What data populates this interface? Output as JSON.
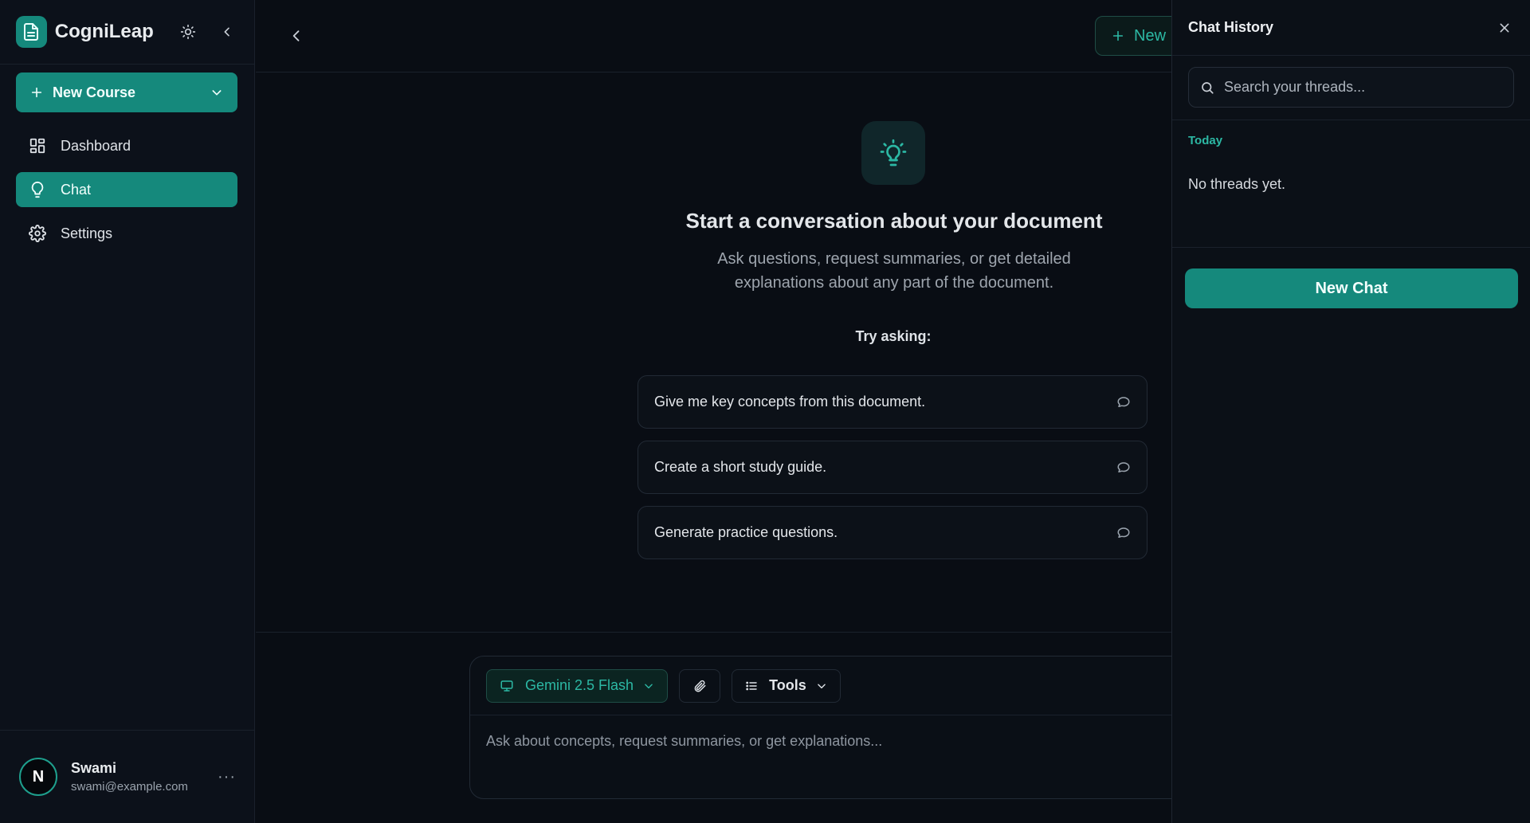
{
  "app": {
    "name": "CogniLeap"
  },
  "sidebar": {
    "new_course_label": "New Course",
    "items": [
      {
        "label": "Dashboard",
        "icon": "dashboard-icon",
        "active": false
      },
      {
        "label": "Chat",
        "icon": "lightbulb-icon",
        "active": true
      },
      {
        "label": "Settings",
        "icon": "gear-icon",
        "active": false
      }
    ],
    "user": {
      "initial": "N",
      "name": "Swami",
      "email": "swami@example.com",
      "more_label": "···"
    }
  },
  "main": {
    "new_button_label": "New",
    "empty_state": {
      "title": "Start a conversation about your document",
      "subtitle": "Ask questions, request summaries, or get detailed explanations about any part of the document.",
      "try_label": "Try asking:",
      "suggestions": [
        "Give me key concepts from this document.",
        "Create a short study guide.",
        "Generate practice questions."
      ]
    },
    "composer": {
      "model_label": "Gemini 2.5 Flash",
      "tools_label": "Tools",
      "input_placeholder": "Ask about concepts, request summaries, or get explanations..."
    }
  },
  "history": {
    "title": "Chat History",
    "search_placeholder": "Search your threads...",
    "group_label": "Today",
    "empty_text": "No threads yet.",
    "new_chat_label": "New Chat"
  },
  "colors": {
    "accent": "#15897c",
    "accent_text": "#2cb8a4",
    "background": "#090d14",
    "sidebar": "#0c111a"
  }
}
